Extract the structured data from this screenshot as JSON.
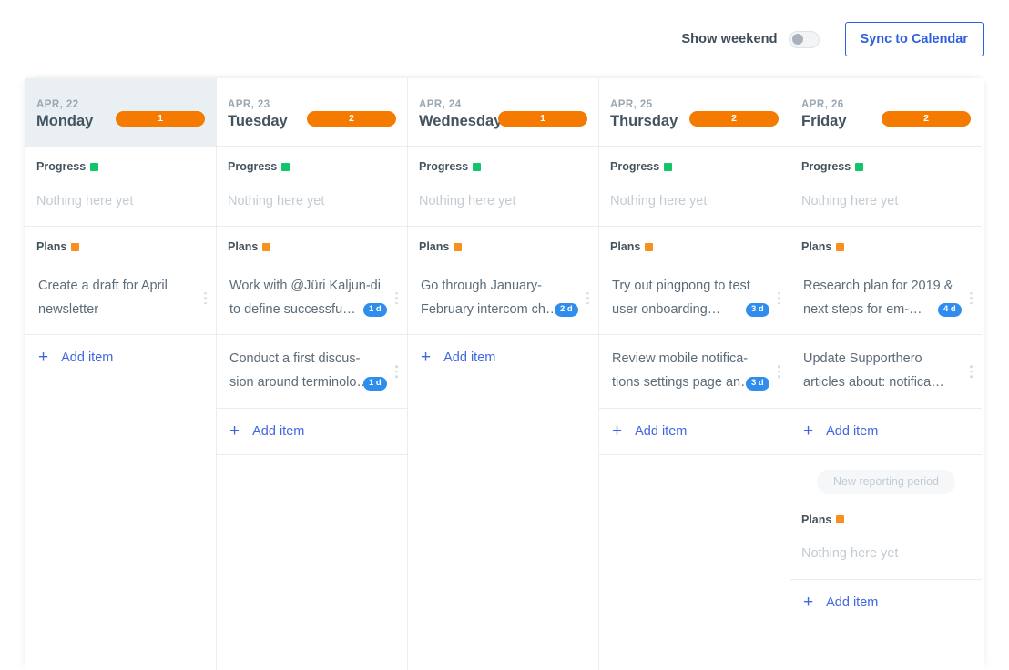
{
  "toolbar": {
    "weekend_label": "Show weekend",
    "weekend_toggle_state": "off",
    "sync_label": "Sync to Calendar",
    "accent_blue": "#2f5fe0"
  },
  "labels": {
    "add_item": "Add item",
    "empty": "Nothing here yet",
    "progress": "Progress",
    "plans": "Plans",
    "new_period": "New reporting period"
  },
  "colors": {
    "count_pill": "#f57a00",
    "progress_square": "#12c46b",
    "plans_square": "#f7901e",
    "day_badge": "#2f8ded",
    "today_header": "#eaeff3"
  },
  "columns": [
    {
      "date": "APR, 22",
      "day": "Monday",
      "count": "1",
      "today": true,
      "progress": {
        "title": "Progress",
        "empty": "Nothing here yet"
      },
      "plans": {
        "title": "Plans",
        "tasks": [
          {
            "text": "Create a draft for April newsletter",
            "badge": ""
          }
        ],
        "add_label": "Add item"
      }
    },
    {
      "date": "APR, 23",
      "day": "Tuesday",
      "count": "2",
      "today": false,
      "progress": {
        "title": "Progress",
        "empty": "Nothing here yet"
      },
      "plans": {
        "title": "Plans",
        "tasks": [
          {
            "text": "Work with @Jüri Kaljun-di to define successfu…",
            "badge": "1 d"
          },
          {
            "text": "Conduct a first discus-sion around terminolo…",
            "badge": "1 d"
          }
        ],
        "add_label": "Add item"
      }
    },
    {
      "date": "APR, 24",
      "day": "Wednesday",
      "count": "1",
      "today": false,
      "progress": {
        "title": "Progress",
        "empty": "Nothing here yet"
      },
      "plans": {
        "title": "Plans",
        "tasks": [
          {
            "text": "Go through January-February intercom ch…",
            "badge": "2 d"
          }
        ],
        "add_label": "Add item"
      }
    },
    {
      "date": "APR, 25",
      "day": "Thursday",
      "count": "2",
      "today": false,
      "progress": {
        "title": "Progress",
        "empty": "Nothing here yet"
      },
      "plans": {
        "title": "Plans",
        "tasks": [
          {
            "text": "Try out pingpong to test user onboarding…",
            "badge": "3 d"
          },
          {
            "text": "Review mobile notifica-tions settings page an…",
            "badge": "3 d"
          }
        ],
        "add_label": "Add item"
      }
    },
    {
      "date": "APR, 26",
      "day": "Friday",
      "count": "2",
      "today": false,
      "progress": {
        "title": "Progress",
        "empty": "Nothing here yet"
      },
      "plans": {
        "title": "Plans",
        "tasks": [
          {
            "text": "Research plan for 2019 & next steps for em-…",
            "badge": "4 d"
          },
          {
            "text": "Update Supporthero articles about: notifica…",
            "badge": ""
          }
        ],
        "add_label": "Add item"
      },
      "next_period": {
        "chip": "New reporting period",
        "plans_title": "Plans",
        "empty": "Nothing here yet",
        "add_label": "Add item"
      }
    }
  ]
}
